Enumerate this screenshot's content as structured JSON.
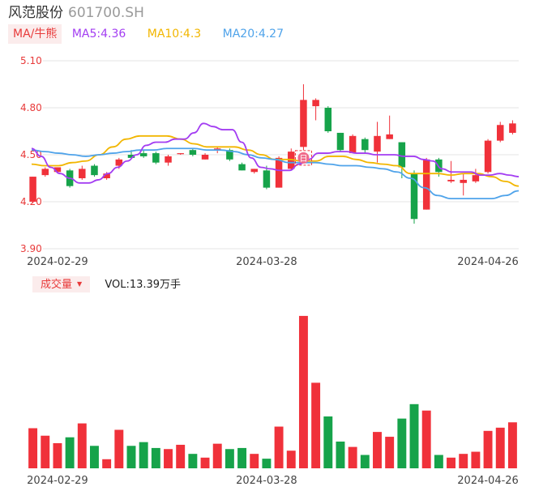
{
  "header": {
    "name": "风范股份",
    "code": "601700.SH"
  },
  "ma_legend": {
    "button": "MA/牛熊",
    "items": [
      {
        "label": "MA5:4.36",
        "color": "#a33df2"
      },
      {
        "label": "MA10:4.3",
        "color": "#f2b600"
      },
      {
        "label": "MA20:4.27",
        "color": "#4fa3ea"
      }
    ]
  },
  "volume_legend": {
    "button": "成交量",
    "caret": "▼",
    "value": "VOL:13.39万手"
  },
  "colors": {
    "up": "#f0313a",
    "down": "#16a34a",
    "grid": "#e6e6e6",
    "axis_label": "#444444",
    "price_label": "#e83a3a"
  },
  "markers": [
    {
      "label": "日",
      "index": 22
    }
  ],
  "chart_data": {
    "type": "candlestick",
    "price_axis": {
      "ylim": [
        3.9,
        5.1
      ],
      "ticks": [
        "5.10",
        "4.80",
        "4.50",
        "4.20",
        "3.90"
      ]
    },
    "x_labels": [
      {
        "index": 2,
        "label": "2024-02-29"
      },
      {
        "index": 19,
        "label": "2024-03-28"
      },
      {
        "index": 37,
        "label": "2024-04-26"
      }
    ],
    "candles": [
      {
        "o": 4.2,
        "h": 4.36,
        "l": 4.19,
        "c": 4.36
      },
      {
        "o": 4.37,
        "h": 4.42,
        "l": 4.36,
        "c": 4.41
      },
      {
        "o": 4.39,
        "h": 4.42,
        "l": 4.38,
        "c": 4.42
      },
      {
        "o": 4.4,
        "h": 4.41,
        "l": 4.29,
        "c": 4.3
      },
      {
        "o": 4.35,
        "h": 4.43,
        "l": 4.34,
        "c": 4.41
      },
      {
        "o": 4.43,
        "h": 4.44,
        "l": 4.36,
        "c": 4.37
      },
      {
        "o": 4.35,
        "h": 4.39,
        "l": 4.34,
        "c": 4.38
      },
      {
        "o": 4.43,
        "h": 4.48,
        "l": 4.41,
        "c": 4.47
      },
      {
        "o": 4.5,
        "h": 4.53,
        "l": 4.48,
        "c": 4.48
      },
      {
        "o": 4.51,
        "h": 4.53,
        "l": 4.48,
        "c": 4.49
      },
      {
        "o": 4.51,
        "h": 4.52,
        "l": 4.44,
        "c": 4.45
      },
      {
        "o": 4.45,
        "h": 4.5,
        "l": 4.43,
        "c": 4.49
      },
      {
        "o": 4.51,
        "h": 4.51,
        "l": 4.5,
        "c": 4.51
      },
      {
        "o": 4.53,
        "h": 4.54,
        "l": 4.49,
        "c": 4.5
      },
      {
        "o": 4.47,
        "h": 4.51,
        "l": 4.47,
        "c": 4.5
      },
      {
        "o": 4.53,
        "h": 4.55,
        "l": 4.51,
        "c": 4.54
      },
      {
        "o": 4.53,
        "h": 4.54,
        "l": 4.46,
        "c": 4.47
      },
      {
        "o": 4.44,
        "h": 4.45,
        "l": 4.4,
        "c": 4.4
      },
      {
        "o": 4.39,
        "h": 4.41,
        "l": 4.38,
        "c": 4.41
      },
      {
        "o": 4.4,
        "h": 4.43,
        "l": 4.28,
        "c": 4.29
      },
      {
        "o": 4.29,
        "h": 4.49,
        "l": 4.29,
        "c": 4.48
      },
      {
        "o": 4.41,
        "h": 4.54,
        "l": 4.4,
        "c": 4.52
      },
      {
        "o": 4.55,
        "h": 4.95,
        "l": 4.53,
        "c": 4.85
      },
      {
        "o": 4.81,
        "h": 4.86,
        "l": 4.72,
        "c": 4.85
      },
      {
        "o": 4.8,
        "h": 4.81,
        "l": 4.64,
        "c": 4.65
      },
      {
        "o": 4.64,
        "h": 4.64,
        "l": 4.52,
        "c": 4.53
      },
      {
        "o": 4.51,
        "h": 4.63,
        "l": 4.51,
        "c": 4.62
      },
      {
        "o": 4.6,
        "h": 4.61,
        "l": 4.51,
        "c": 4.53
      },
      {
        "o": 4.52,
        "h": 4.71,
        "l": 4.45,
        "c": 4.62
      },
      {
        "o": 4.6,
        "h": 4.75,
        "l": 4.6,
        "c": 4.63
      },
      {
        "o": 4.58,
        "h": 4.58,
        "l": 4.35,
        "c": 4.42
      },
      {
        "o": 4.38,
        "h": 4.4,
        "l": 4.06,
        "c": 4.09
      },
      {
        "o": 4.15,
        "h": 4.48,
        "l": 4.15,
        "c": 4.47
      },
      {
        "o": 4.47,
        "h": 4.48,
        "l": 4.36,
        "c": 4.39
      },
      {
        "o": 4.33,
        "h": 4.46,
        "l": 4.32,
        "c": 4.34
      },
      {
        "o": 4.32,
        "h": 4.38,
        "l": 4.24,
        "c": 4.34
      },
      {
        "o": 4.33,
        "h": 4.41,
        "l": 4.32,
        "c": 4.37
      },
      {
        "o": 4.39,
        "h": 4.6,
        "l": 4.38,
        "c": 4.59
      },
      {
        "o": 4.59,
        "h": 4.71,
        "l": 4.58,
        "c": 4.69
      },
      {
        "o": 4.64,
        "h": 4.72,
        "l": 4.63,
        "c": 4.7
      }
    ],
    "ma5": [
      4.54,
      4.49,
      4.42,
      4.38,
      4.35,
      4.32,
      4.32,
      4.34,
      4.38,
      4.42,
      4.46,
      4.5,
      4.56,
      4.58,
      4.58,
      4.6,
      4.6,
      4.64,
      4.7,
      4.68,
      4.66,
      4.66,
      4.58,
      4.48,
      4.42,
      4.41,
      4.4,
      4.4,
      4.44,
      4.47,
      4.51,
      4.51,
      4.52,
      4.52,
      4.51,
      4.51,
      4.5,
      4.5,
      4.5,
      4.49,
      4.49,
      4.47,
      4.46,
      4.41,
      4.39,
      4.39,
      4.39,
      4.37,
      4.37,
      4.38,
      4.37,
      4.36
    ],
    "ma10": [
      4.44,
      4.43,
      4.43,
      4.45,
      4.46,
      4.5,
      4.55,
      4.6,
      4.62,
      4.62,
      4.62,
      4.6,
      4.57,
      4.55,
      4.55,
      4.55,
      4.53,
      4.5,
      4.47,
      4.47,
      4.46,
      4.46,
      4.49,
      4.49,
      4.47,
      4.45,
      4.44,
      4.43,
      4.38,
      4.38,
      4.38,
      4.37,
      4.38,
      4.38,
      4.36,
      4.33,
      4.3
    ],
    "ma20": [
      4.53,
      4.52,
      4.51,
      4.5,
      4.49,
      4.5,
      4.51,
      4.52,
      4.53,
      4.53,
      4.54,
      4.54,
      4.54,
      4.53,
      4.53,
      4.52,
      4.5,
      4.48,
      4.47,
      4.45,
      4.45,
      4.45,
      4.44,
      4.43,
      4.43,
      4.42,
      4.41,
      4.39,
      4.35,
      4.29,
      4.24,
      4.22,
      4.22,
      4.22,
      4.22,
      4.24,
      4.27
    ],
    "volume": [
      0.75,
      0.61,
      0.47,
      0.58,
      0.84,
      0.42,
      0.17,
      0.72,
      0.42,
      0.49,
      0.38,
      0.36,
      0.44,
      0.27,
      0.2,
      0.46,
      0.36,
      0.38,
      0.27,
      0.18,
      0.78,
      0.33,
      2.85,
      1.6,
      0.97,
      0.5,
      0.4,
      0.25,
      0.68,
      0.59,
      0.93,
      1.2,
      1.08,
      0.25,
      0.2,
      0.27,
      0.31,
      0.7,
      0.76,
      0.86
    ],
    "volume_ylim": [
      0,
      3.0
    ]
  }
}
